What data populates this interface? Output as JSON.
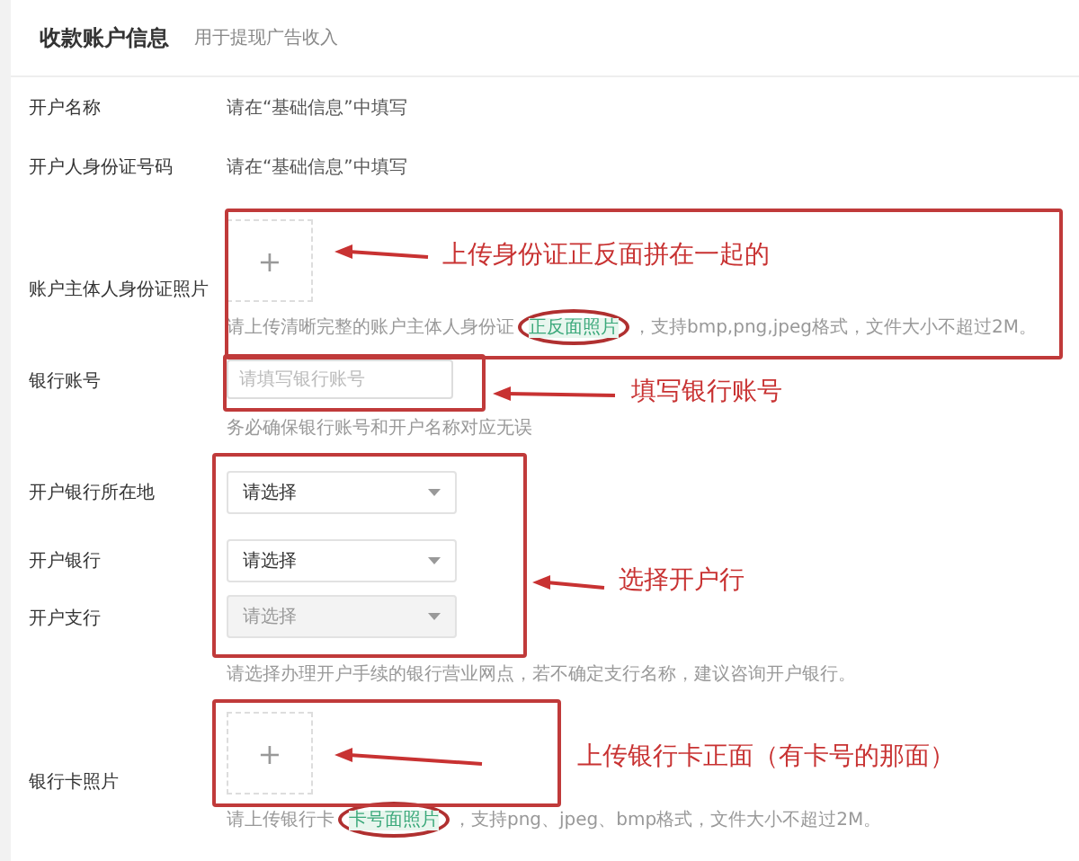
{
  "header": {
    "title": "收款账户信息",
    "subtitle": "用于提现广告收入"
  },
  "fields": [
    {
      "kind": "text",
      "label": "开户名称",
      "value": "请在“基础信息”中填写"
    },
    {
      "kind": "text",
      "label": "开户人身份证号码",
      "value": "请在“基础信息”中填写"
    },
    {
      "kind": "upload",
      "label": "账户主体人身份证照片",
      "upload_icon": "+",
      "hint": {
        "before": "请上传清晰完整的账户主体人身份证",
        "link": "正反面照片",
        "after": "，支持bmp,png,jpeg格式，文件大小不超过2M。",
        "circled": true
      }
    },
    {
      "kind": "input",
      "label": "银行账号",
      "placeholder": "请填写银行账号",
      "hint": {
        "before": "务必确保银行账号和开户名称对应无误"
      }
    },
    {
      "kind": "select",
      "label": "开户银行所在地",
      "value": "请选择",
      "disabled": false
    },
    {
      "kind": "select",
      "label": "开户银行",
      "value": "请选择",
      "disabled": false
    },
    {
      "kind": "select",
      "label": "开户支行",
      "value": "请选择",
      "disabled": true,
      "hint": {
        "before": "请选择办理开户手续的银行营业网点，若不确定支行名称，建议咨询开户银行。"
      }
    },
    {
      "kind": "upload",
      "label": "银行卡照片",
      "upload_icon": "+",
      "hint": {
        "before": "请上传银行卡",
        "link": "卡号面照片",
        "after": "，支持png、jpeg、bmp格式，文件大小不超过2M。",
        "circled": true
      }
    }
  ],
  "annotations": [
    {
      "text": "上传身份证正反面拼在一起的"
    },
    {
      "text": "填写银行账号"
    },
    {
      "text": "选择开户行"
    },
    {
      "text": "上传银行卡正面（有卡号的那面）"
    }
  ]
}
